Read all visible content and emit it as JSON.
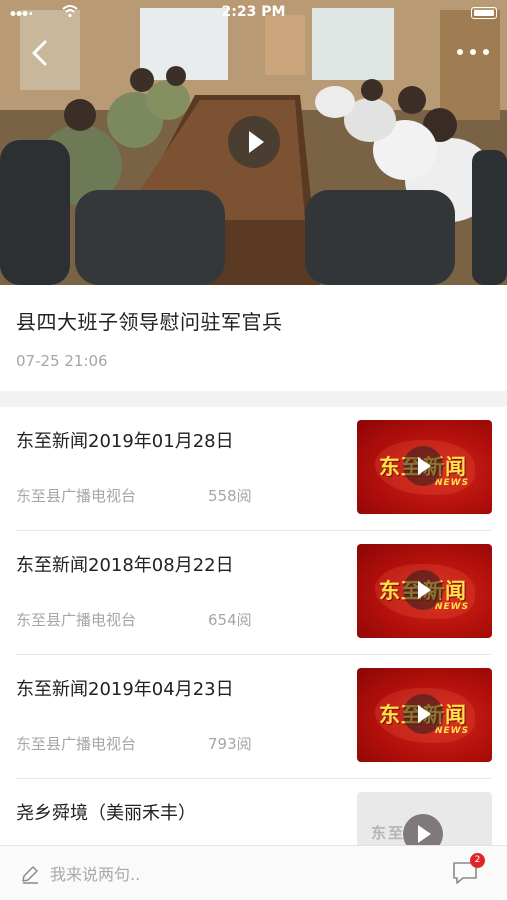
{
  "status_bar": {
    "time": "2:23 PM",
    "signal": "signal-icon",
    "wifi": "wifi-icon",
    "battery": "battery-icon"
  },
  "hero": {
    "back_icon": "back-arrow-icon",
    "more_icon": "more-dots-icon",
    "play_icon": "play-icon"
  },
  "article": {
    "title": "县四大班子领导慰问驻军官兵",
    "time": "07-25 21:06"
  },
  "news_list": [
    {
      "title": "东至新闻2019年01月28日",
      "source": "东至县广播电视台",
      "reads": "558阅",
      "thumb_logo": "东至新闻",
      "thumb_sub": "NEWS"
    },
    {
      "title": "东至新闻2018年08月22日",
      "source": "东至县广播电视台",
      "reads": "654阅",
      "thumb_logo": "东至新闻",
      "thumb_sub": "NEWS"
    },
    {
      "title": "东至新闻2019年04月23日",
      "source": "东至县广播电视台",
      "reads": "793阅",
      "thumb_logo": "东至新闻",
      "thumb_sub": "NEWS"
    },
    {
      "title": "尧乡舜境（美丽禾丰）",
      "thumb_logo": "东至"
    }
  ],
  "comment_bar": {
    "placeholder": "我来说两句..",
    "comment_count": "2",
    "pencil_icon": "pencil-icon",
    "comment_icon": "comment-bubble-icon"
  },
  "colors": {
    "accent_red": "#e0252a",
    "thumb_red": "#c41a12",
    "muted_text": "#a6a6a6"
  }
}
